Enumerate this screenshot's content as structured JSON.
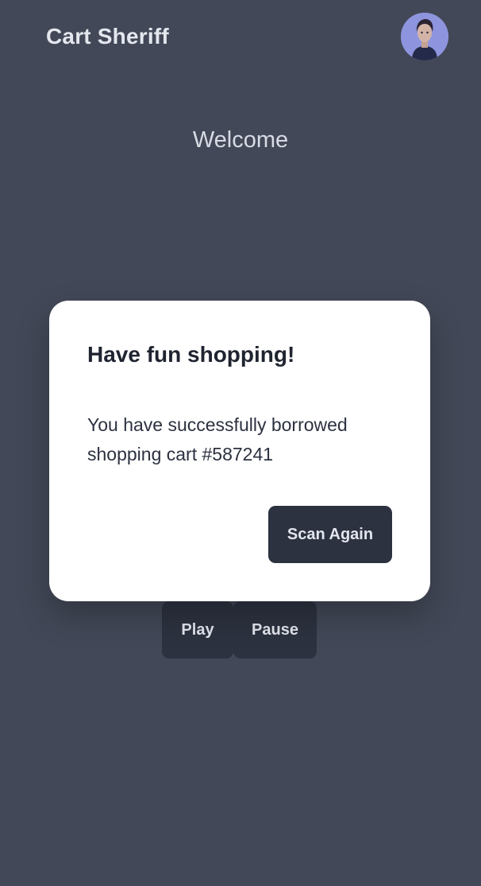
{
  "header": {
    "app_title": "Cart Sheriff",
    "avatar_icon": "user-avatar-photo"
  },
  "main": {
    "welcome_text": "Welcome",
    "controls": {
      "play_label": "Play",
      "pause_label": "Pause"
    }
  },
  "modal": {
    "title": "Have fun shopping!",
    "message": "You have successfully borrowed shopping cart #587241",
    "scan_again_label": "Scan Again"
  },
  "colors": {
    "background": "#424857",
    "button_bg": "#2d3240",
    "modal_bg": "#ffffff",
    "avatar_bg": "#8e95de"
  }
}
